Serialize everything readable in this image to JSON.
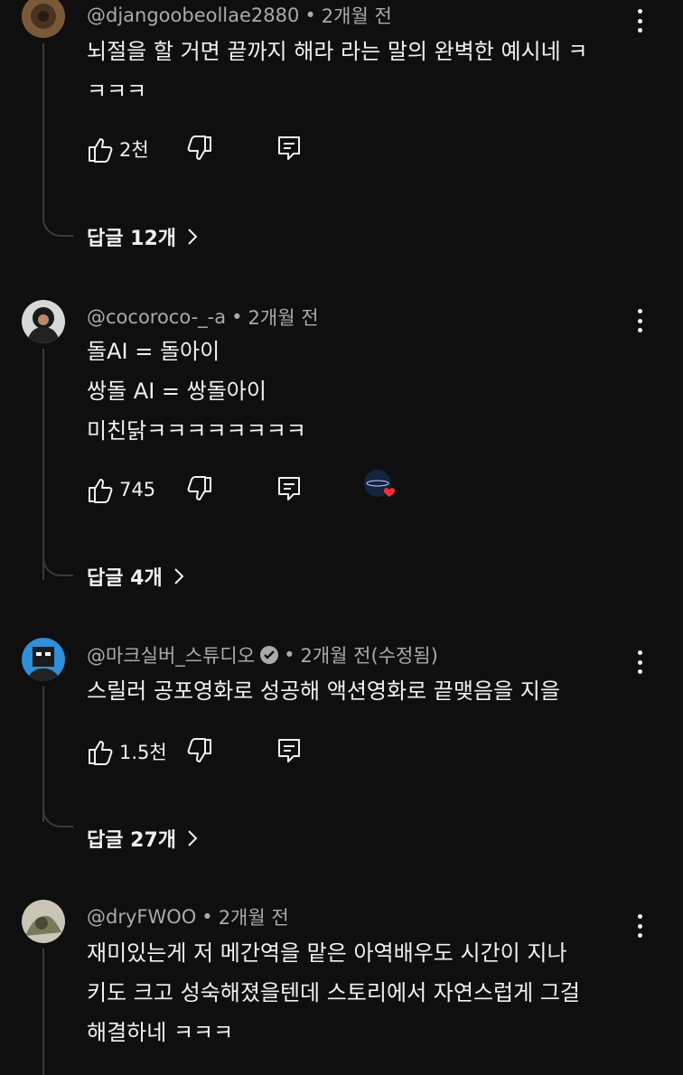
{
  "comments": [
    {
      "author": "@djangoobeollae2880",
      "time": "2개월 전",
      "edited": "",
      "verified": false,
      "lines": [
        "뇌절을 할 거면 끝까지 해라 라는 말의 완벽한 예시네 ㅋ",
        "ㅋㅋㅋ"
      ],
      "likes": "2천",
      "replies": "답글 12개",
      "creator_heart": false,
      "avatar_color": "#6b4a2a"
    },
    {
      "author": "@cocoroco-_-a",
      "time": "2개월 전",
      "edited": "",
      "verified": false,
      "lines": [
        "돌AI = 돌아이",
        "쌍돌 AI = 쌍돌아이",
        "미친닭ㅋㅋㅋㅋㅋㅋㅋㅋ"
      ],
      "likes": "745",
      "replies": "답글 4개",
      "creator_heart": true,
      "avatar_color": "#5a5a5a"
    },
    {
      "author": "@마크실버_스튜디오",
      "time": "2개월 전",
      "edited": "(수정됨)",
      "verified": true,
      "lines": [
        "스릴러 공포영화로 성공해 액션영화로 끝맺음을 지을"
      ],
      "likes": "1.5천",
      "replies": "답글 27개",
      "creator_heart": false,
      "avatar_color": "#2f8fd8"
    },
    {
      "author": "@dryFWOO",
      "time": "2개월 전",
      "edited": "",
      "verified": false,
      "lines": [
        "재미있는게 저 메간역을 맡은 아역배우도 시간이 지나",
        "키도 크고 성숙해졌을텐데 스토리에서 자연스럽게 그걸",
        "해결하네 ㅋㅋㅋ"
      ],
      "likes": "",
      "replies": "",
      "creator_heart": false,
      "avatar_color": "#8a8a6a"
    }
  ],
  "separator": "•",
  "colors": {
    "background": "#0f0f0f",
    "text": "#f1f1f1",
    "meta": "#aaaaaa",
    "heart": "#ff2d3b"
  }
}
